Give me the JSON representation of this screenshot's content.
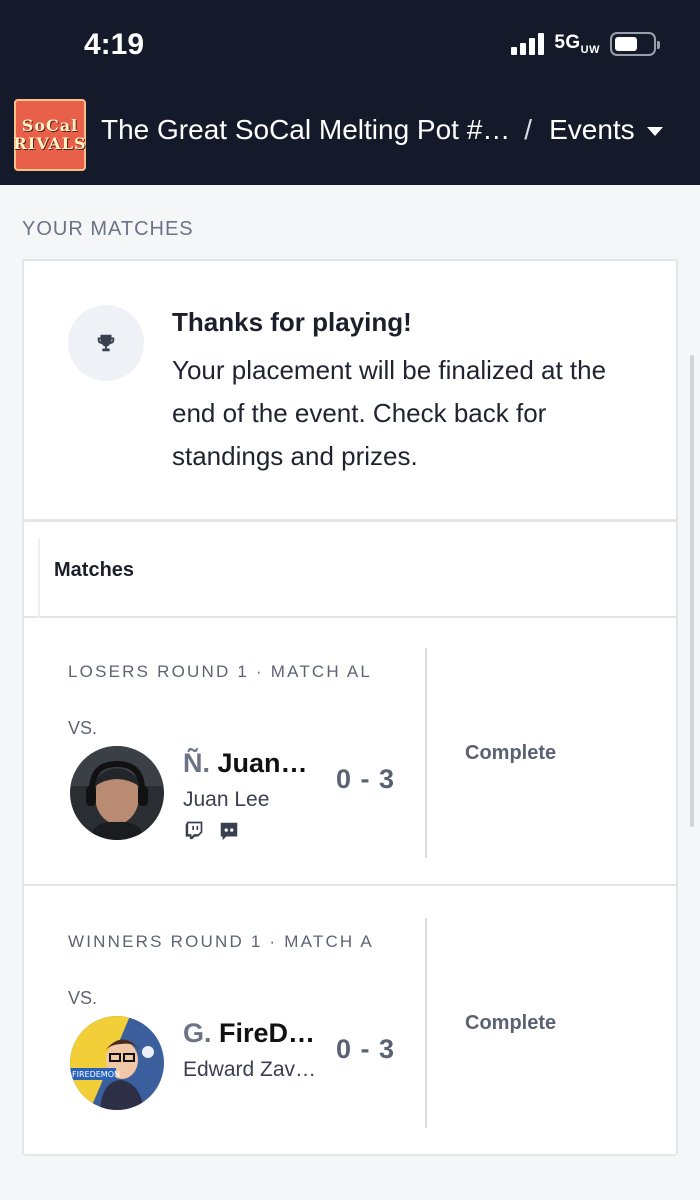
{
  "status_bar": {
    "time": "4:19",
    "network": "5G",
    "network_sub": "UW"
  },
  "header": {
    "logo_line1": "SoCal",
    "logo_line2": "RIVALS",
    "event_name": "The Great SoCal Melting Pot #…",
    "separator": "/",
    "section": "Events"
  },
  "your_matches": {
    "label": "YOUR MATCHES",
    "thanks_title": "Thanks for playing!",
    "thanks_body": "Your placement will be finalized at the end of the event. Check back for standings and prizes."
  },
  "matches_panel": {
    "title": "Matches",
    "items": [
      {
        "round": "LOSERS ROUND 1 · MATCH AL",
        "vs": "VS.",
        "prefix": "Ñ.",
        "gamertag": "Juan…",
        "real_name": "Juan Lee",
        "score": "0 - 3",
        "state": "Complete",
        "socials": [
          "twitch-icon",
          "discord-icon"
        ]
      },
      {
        "round": "WINNERS ROUND 1 · MATCH A",
        "vs": "VS.",
        "prefix": "G.",
        "gamertag": "FireD…",
        "real_name": "Edward Zav…",
        "score": "0 - 3",
        "state": "Complete",
        "avatar_text": "FIREDEMON"
      }
    ]
  },
  "colors": {
    "header_bg": "#151a2a",
    "page_bg": "#f5f6f8",
    "logo_bg": "#e85f4a",
    "muted_text": "#5a6272"
  }
}
